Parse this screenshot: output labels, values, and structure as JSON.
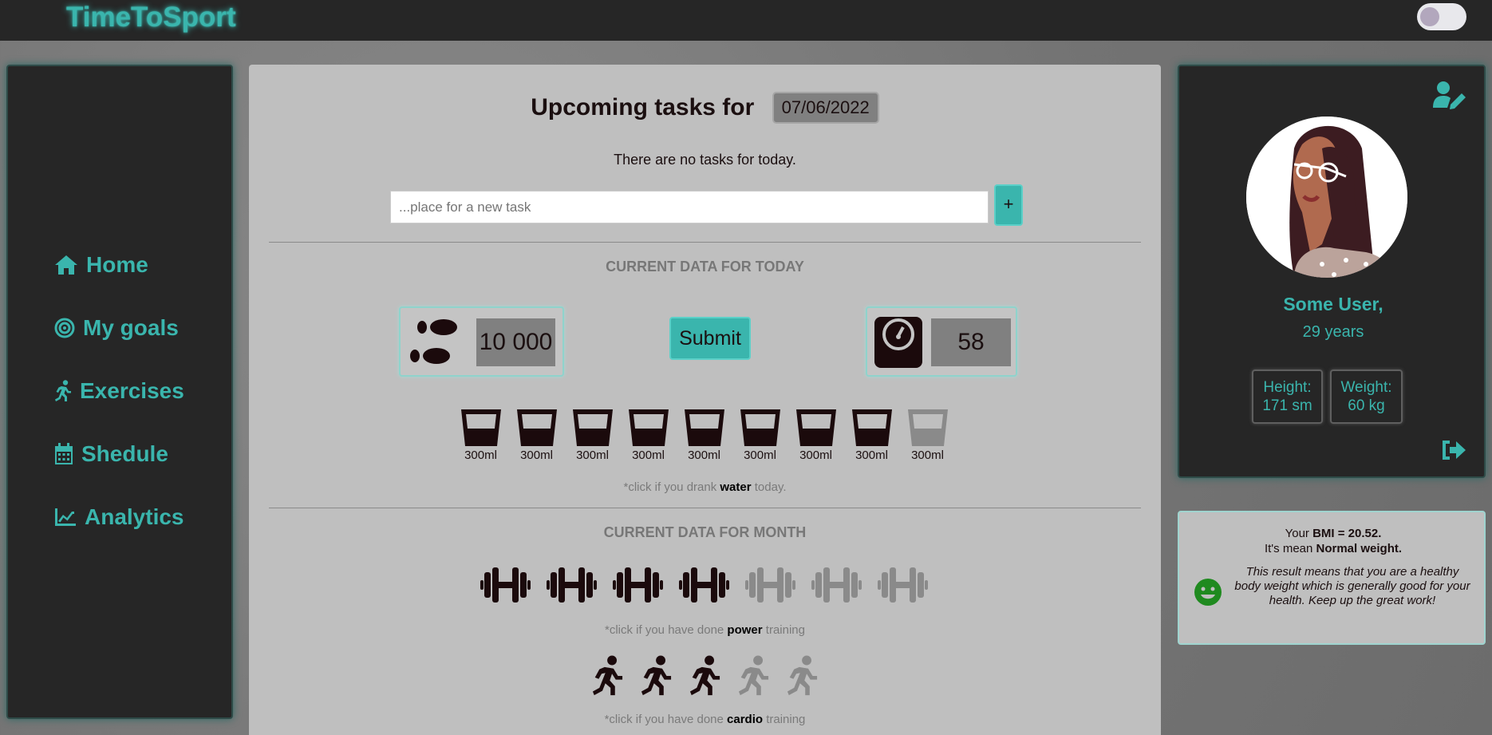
{
  "app": {
    "title": "TimeToSport"
  },
  "theme": {
    "accent": "#3ab5ad",
    "dark": "#262626",
    "done": "#1b0a0c",
    "undone": "#8a8a8a"
  },
  "sidebar": {
    "items": [
      {
        "label": "Home",
        "icon": "home-icon"
      },
      {
        "label": "My goals",
        "icon": "target-icon"
      },
      {
        "label": "Exercises",
        "icon": "running-icon"
      },
      {
        "label": "Shedule",
        "icon": "calendar-icon"
      },
      {
        "label": "Analytics",
        "icon": "chart-line-icon"
      }
    ]
  },
  "main": {
    "heading": "Upcoming tasks for",
    "date": "07/06/2022",
    "no_tasks": "There are no tasks for today.",
    "task_placeholder": "...place for a new task",
    "add_label": "+",
    "today_title": "CURRENT DATA FOR TODAY",
    "steps": "10 000",
    "submit_label": "Submit",
    "weight": "58",
    "water": {
      "cup_label": "300ml",
      "cups": [
        true,
        true,
        true,
        true,
        true,
        true,
        true,
        true,
        false
      ],
      "hint_pre": "*click if you drank ",
      "hint_bold": "water",
      "hint_post": " today."
    },
    "month_title": "CURRENT DATA FOR MONTH",
    "power": {
      "done": [
        true,
        true,
        true,
        true,
        false,
        false,
        false
      ],
      "hint_pre": "*click if you have done ",
      "hint_bold": "power",
      "hint_post": " training"
    },
    "cardio": {
      "done": [
        true,
        true,
        true,
        false,
        false
      ],
      "hint_pre": "*click if you have done ",
      "hint_bold": "cardio",
      "hint_post": " training"
    }
  },
  "profile": {
    "name": "Some User,",
    "age": "29 years",
    "height_label": "Height:",
    "height_value": "171 sm",
    "weight_label": "Weight:",
    "weight_value": "60 kg"
  },
  "bmi": {
    "line1_pre": "Your ",
    "line1_bold": "BMI = 20.52.",
    "line2_pre": "It's mean ",
    "line2_bold": "Normal weight.",
    "description": "This result means that you are a healthy body weight which is generally good for your health. Keep up the great work!"
  }
}
